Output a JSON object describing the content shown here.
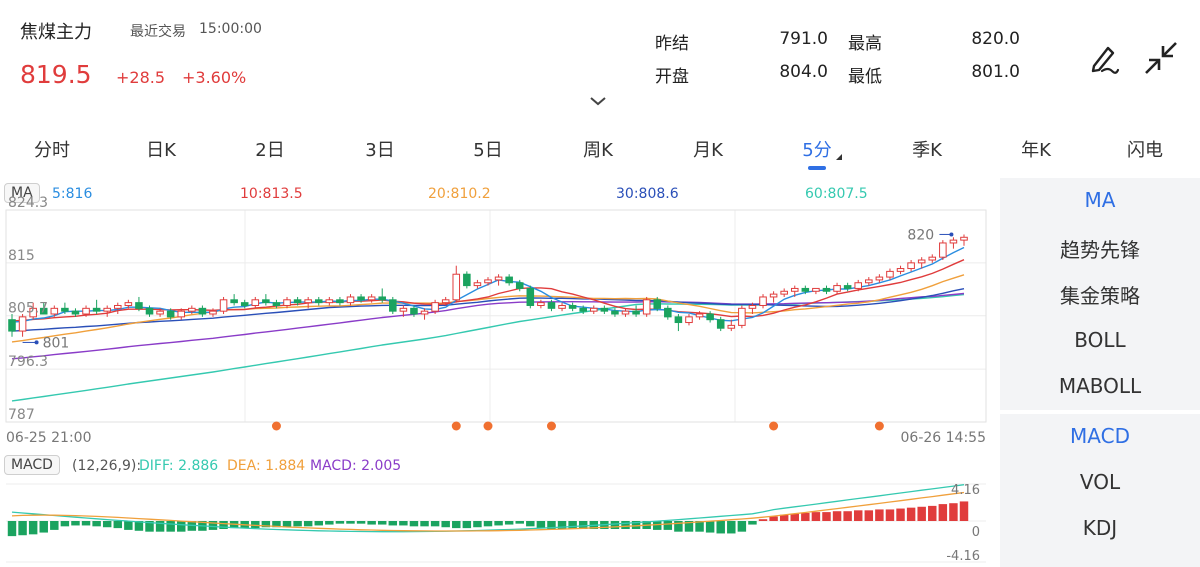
{
  "header": {
    "title": "焦煤主力",
    "last_trade_label": "最近交易",
    "last_trade_time": "15:00:00",
    "price": "819.5",
    "change": "+28.5",
    "change_pct": "+3.60%",
    "stats": {
      "prev_settle_label": "昨结",
      "prev_settle": "791.0",
      "high_label": "最高",
      "high": "820.0",
      "open_label": "开盘",
      "open": "804.0",
      "low_label": "最低",
      "low": "801.0"
    }
  },
  "tabs": [
    "分时",
    "日K",
    "2日",
    "3日",
    "5日",
    "周K",
    "月K",
    "5分",
    "季K",
    "年K",
    "闪电"
  ],
  "active_tab": "5分",
  "ma_legend": {
    "badge": "MA",
    "ma5": "5:816",
    "ma10": "10:813.5",
    "ma20": "20:810.2",
    "ma30": "30:808.6",
    "ma60": "60:807.5"
  },
  "price_axis": {
    "top": "824.3",
    "mid_upper": "815",
    "mid": "805.7",
    "mid_lower": "796.3",
    "bottom": "787"
  },
  "annotations": {
    "high_marker": "820",
    "low_marker": "801"
  },
  "time_axis": {
    "start": "06-25 21:00",
    "end": "06-26 14:55"
  },
  "macd_legend": {
    "badge": "MACD",
    "params": "(12,26,9):",
    "diff": "DIFF: 2.886",
    "dea": "DEA: 1.884",
    "macd": "MACD: 2.005"
  },
  "macd_axis": {
    "top": "4.16",
    "zero": "0",
    "bottom": "-4.16"
  },
  "side_panel_top": [
    "MA",
    "趋势先锋",
    "集金策略",
    "BOLL",
    "MABOLL"
  ],
  "side_panel_bottom": [
    "MACD",
    "VOL",
    "KDJ"
  ],
  "colors": {
    "up": "#e03c3c",
    "down": "#1aa35f",
    "accent": "#2f6fe4",
    "ma5": "#2a8de0",
    "ma10": "#e03c3c",
    "ma20": "#f0a03c",
    "ma30": "#2a4fb8",
    "ma60": "#35c9b0",
    "ma_extra": "#8a3cc8",
    "signal_dot": "#f07030",
    "diff": "#35c9b0",
    "dea": "#f0a03c",
    "macd": "#8a3cc8"
  },
  "chart_data": {
    "type": "candlestick",
    "ylim": [
      787,
      824.3
    ],
    "ohlc": [
      [
        805,
        806,
        802,
        803
      ],
      [
        803,
        806,
        802,
        805.5
      ],
      [
        805.5,
        808,
        805,
        807
      ],
      [
        807,
        808,
        806,
        806
      ],
      [
        806,
        807.5,
        805.5,
        807
      ],
      [
        807,
        808,
        806,
        806.5
      ],
      [
        806.5,
        807,
        805.5,
        806
      ],
      [
        806,
        807.5,
        805.5,
        807
      ],
      [
        807,
        808.5,
        806,
        806.5
      ],
      [
        806.5,
        807.5,
        805.5,
        807
      ],
      [
        807,
        808,
        806,
        807.5
      ],
      [
        807.5,
        808.5,
        807,
        808
      ],
      [
        808,
        809,
        806.5,
        807
      ],
      [
        807,
        807.5,
        805.5,
        806
      ],
      [
        806,
        807,
        805.5,
        806.5
      ],
      [
        806.5,
        807,
        805,
        805.5
      ],
      [
        805.5,
        807,
        805,
        806.5
      ],
      [
        806.5,
        807.5,
        806,
        807
      ],
      [
        807,
        807.5,
        805.5,
        806
      ],
      [
        806,
        807,
        805.5,
        806.5
      ],
      [
        806.5,
        809,
        806,
        808.5
      ],
      [
        808.5,
        809.5,
        807.5,
        808
      ],
      [
        808,
        808.5,
        807,
        807.5
      ],
      [
        807.5,
        809,
        807,
        808.5
      ],
      [
        808.5,
        809.5,
        807.5,
        808
      ],
      [
        808,
        808.5,
        807,
        807.5
      ],
      [
        807.5,
        809,
        807,
        808.5
      ],
      [
        808.5,
        809,
        807.5,
        808
      ],
      [
        808,
        809,
        807,
        808.5
      ],
      [
        808.5,
        809,
        807.5,
        808
      ],
      [
        808,
        809,
        807.5,
        808.5
      ],
      [
        808.5,
        809,
        807.5,
        808
      ],
      [
        808,
        809.5,
        807.5,
        809
      ],
      [
        809,
        809.5,
        808,
        808.5
      ],
      [
        808.5,
        809.5,
        808,
        809
      ],
      [
        809,
        810.5,
        808,
        808.5
      ],
      [
        808.5,
        809,
        806,
        806.5
      ],
      [
        806.5,
        807.5,
        805.5,
        807
      ],
      [
        807,
        807.5,
        805.5,
        806
      ],
      [
        806,
        807,
        805,
        806.5
      ],
      [
        806.5,
        808.5,
        806,
        808
      ],
      [
        808,
        809,
        807.5,
        808.5
      ],
      [
        808.5,
        814.5,
        808,
        813
      ],
      [
        813,
        813.5,
        810.5,
        811
      ],
      [
        811,
        812,
        810.5,
        811.5
      ],
      [
        811.5,
        812.5,
        811,
        812
      ],
      [
        812,
        813,
        811,
        812.5
      ],
      [
        812.5,
        813,
        811,
        811.5
      ],
      [
        811.5,
        812,
        810,
        810.5
      ],
      [
        810.5,
        811,
        807,
        807.5
      ],
      [
        807.5,
        808.5,
        807,
        808
      ],
      [
        808,
        808.5,
        806.5,
        807
      ],
      [
        807,
        808,
        806.5,
        807.5
      ],
      [
        807.5,
        808,
        806.5,
        807
      ],
      [
        807,
        807.5,
        806,
        806.5
      ],
      [
        806.5,
        807.5,
        806,
        807
      ],
      [
        807,
        807.5,
        806,
        806.5
      ],
      [
        806.5,
        807,
        805.5,
        806
      ],
      [
        806,
        807,
        805.5,
        806.5
      ],
      [
        806.5,
        807.5,
        805.5,
        806
      ],
      [
        806,
        809,
        805.5,
        808.5
      ],
      [
        808.5,
        809,
        806.5,
        807
      ],
      [
        807,
        807.5,
        805,
        805.5
      ],
      [
        805.5,
        806,
        803,
        804.5
      ],
      [
        804.5,
        806,
        804,
        805.5
      ],
      [
        805.5,
        806.5,
        805,
        806
      ],
      [
        806,
        806.5,
        804.5,
        805
      ],
      [
        805,
        805.5,
        803,
        803.5
      ],
      [
        803.5,
        805,
        803,
        804
      ],
      [
        804,
        807.5,
        803.5,
        807
      ],
      [
        807,
        808,
        806,
        807.5
      ],
      [
        807.5,
        809.5,
        807,
        809
      ],
      [
        809,
        810,
        808,
        809.5
      ],
      [
        809.5,
        810.5,
        809,
        810
      ],
      [
        810,
        811,
        809,
        810.5
      ],
      [
        810.5,
        811,
        809.5,
        810
      ],
      [
        810,
        810.5,
        809.5,
        810.5
      ],
      [
        810.5,
        811,
        809.5,
        810
      ],
      [
        810,
        811.5,
        809.5,
        811
      ],
      [
        811,
        811.5,
        810,
        810.5
      ],
      [
        810.5,
        812,
        810,
        811.5
      ],
      [
        811.5,
        812.5,
        811,
        812
      ],
      [
        812,
        813,
        811.5,
        812.5
      ],
      [
        812.5,
        814,
        812,
        813.5
      ],
      [
        813.5,
        814.5,
        813,
        814
      ],
      [
        814,
        815.5,
        813.5,
        815
      ],
      [
        815,
        816,
        814,
        815.5
      ],
      [
        815.5,
        816.5,
        815,
        816
      ],
      [
        816,
        819,
        815.5,
        818.5
      ],
      [
        818.5,
        819.5,
        817.5,
        819
      ],
      [
        819,
        820,
        818,
        819.5
      ]
    ],
    "macd_values": [
      -1.7,
      -1.6,
      -1.5,
      -1.3,
      -1.0,
      -0.6,
      -0.5,
      -0.5,
      -0.6,
      -0.7,
      -0.8,
      -1.0,
      -1.1,
      -1.2,
      -1.2,
      -1.2,
      -1.2,
      -1.1,
      -1.1,
      -1.0,
      -0.9,
      -0.8,
      -0.8,
      -0.8,
      -0.7,
      -0.7,
      -0.7,
      -0.6,
      -0.6,
      -0.5,
      -0.4,
      -0.3,
      -0.3,
      -0.3,
      -0.4,
      -0.4,
      -0.5,
      -0.5,
      -0.6,
      -0.6,
      -0.6,
      -0.7,
      -0.8,
      -0.8,
      -0.7,
      -0.6,
      -0.5,
      -0.4,
      -0.3,
      -0.6,
      -0.8,
      -0.9,
      -0.9,
      -0.9,
      -0.9,
      -0.9,
      -0.9,
      -0.9,
      -0.9,
      -0.9,
      -0.9,
      -1.0,
      -1.0,
      -1.2,
      -1.2,
      -1.2,
      -1.3,
      -1.4,
      -1.4,
      -1.2,
      -0.4,
      0.2,
      0.5,
      0.7,
      0.8,
      0.9,
      1.0,
      1.0,
      1.1,
      1.1,
      1.2,
      1.2,
      1.3,
      1.3,
      1.4,
      1.5,
      1.6,
      1.7,
      1.9,
      2.0,
      2.2
    ],
    "macd_ylim": [
      -4.16,
      4.16
    ],
    "signal_dot_indices": [
      25,
      42,
      45,
      51,
      72,
      82
    ]
  }
}
